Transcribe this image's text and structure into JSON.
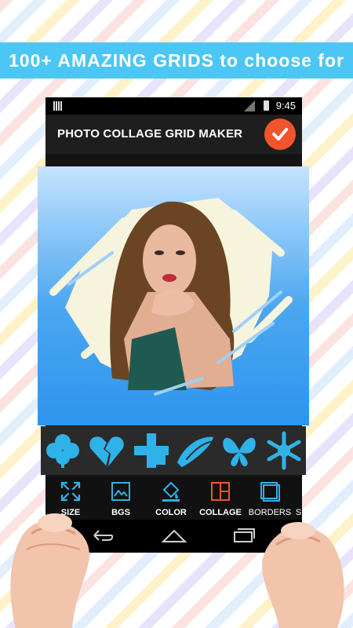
{
  "banner": {
    "text": "100+ AMAZING GRIDS to choose for"
  },
  "statusbar": {
    "time": "9:45"
  },
  "appbar": {
    "title": "PHOTO COLLAGE GRID MAKER",
    "done_icon": "check-icon"
  },
  "shapes": [
    {
      "name": "clover-shape"
    },
    {
      "name": "broken-heart-shape"
    },
    {
      "name": "cross-shape"
    },
    {
      "name": "brush-stroke-shape"
    },
    {
      "name": "butterfly-shape"
    },
    {
      "name": "snowflake-shape"
    }
  ],
  "toolbar": {
    "items": [
      {
        "label": "SIZE",
        "icon": "resize-icon"
      },
      {
        "label": "BGS",
        "icon": "image-icon"
      },
      {
        "label": "COLOR",
        "icon": "paint-bucket-icon"
      },
      {
        "label": "COLLAGE",
        "icon": "layout-icon"
      },
      {
        "label": "BORDERS",
        "icon": "border-icon"
      },
      {
        "label": "S",
        "icon": ""
      }
    ]
  },
  "colors": {
    "accent": "#4cc6f4",
    "done_button": "#f2552c",
    "shape_fill": "#2fb2e8",
    "collage_icon": "#f2552c"
  }
}
